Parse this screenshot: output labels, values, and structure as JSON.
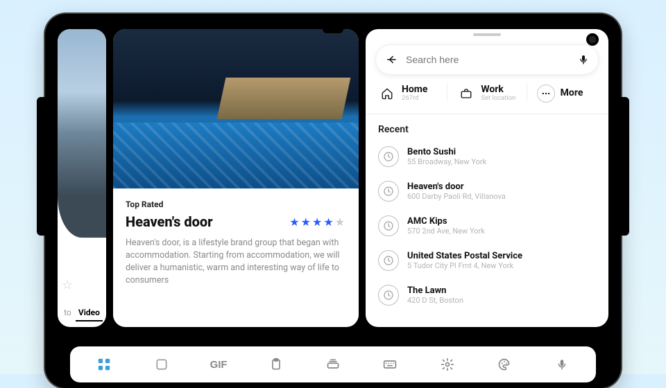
{
  "gallery": {
    "tabs": [
      "to",
      "Video"
    ],
    "active_tab_index": 1
  },
  "listing": {
    "badge": "Top Rated",
    "title": "Heaven's door",
    "rating": 4,
    "rating_max": 5,
    "description": "Heaven's door, is a lifestyle brand group that began with accommodation. Starting from accommodation, we will deliver a humanistic, warm and interesting way of life to consumers"
  },
  "search": {
    "placeholder": "Search here"
  },
  "chips": [
    {
      "icon": "home",
      "label": "Home",
      "sub": "267rd"
    },
    {
      "icon": "briefcase",
      "label": "Work",
      "sub": "Set location"
    },
    {
      "icon": "more",
      "label": "More",
      "sub": ""
    }
  ],
  "recent_title": "Recent",
  "recent": [
    {
      "name": "Bento Sushi",
      "addr": "55 Broadway, New York"
    },
    {
      "name": "Heaven's door",
      "addr": "600 Darby Paoli Rd, Villanova"
    },
    {
      "name": "AMC Kips",
      "addr": "570 2nd Ave, New York"
    },
    {
      "name": "United States Postal Service",
      "addr": "5 Tudor City Pl Frnt 4, New York"
    },
    {
      "name": "The Lawn",
      "addr": "420 D St, Boston"
    }
  ],
  "toolbar": [
    "grid",
    "square",
    "gif",
    "clipboard",
    "stack",
    "keyboard",
    "gear",
    "palette",
    "mic"
  ]
}
